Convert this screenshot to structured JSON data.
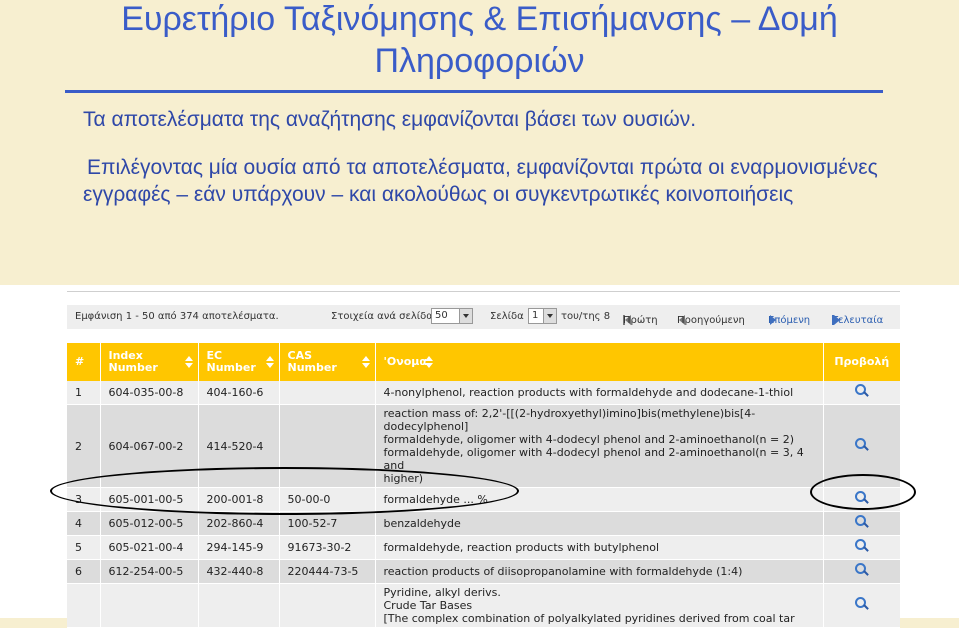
{
  "slide": {
    "title_line1": "Ευρετήριο Ταξινόμησης & Επισήμανσης – Δομή",
    "title_line2": "Πληροφοριών",
    "para1": "Τα αποτελέσματα της αναζήτησης εμφανίζονται βάσει των ουσιών.",
    "para2": "Επιλέγοντας μία ουσία από τα αποτελέσματα, εμφανίζονται πρώτα οι εναρμονισμένες εγγραφές – εάν υπάρχουν – και ακολούθως οι συγκεντρωτικές κοινοποιήσεις"
  },
  "pager": {
    "showing": "Εμφάνιση 1 - 50 από 374 αποτελέσματα.",
    "per_page_label": "Στοιχεία ανά σελίδα",
    "per_page_value": "50",
    "page_label": "Σελίδα",
    "page_value": "1",
    "of_label": "του/της 8",
    "first": "Πρώτη",
    "prev": "Προηγούμενη",
    "next": "Επόμενη",
    "last": "Τελευταία"
  },
  "table": {
    "headers": {
      "num": "#",
      "index": [
        "Index",
        "Number"
      ],
      "ec": [
        "EC",
        "Number"
      ],
      "cas": [
        "CAS",
        "Number"
      ],
      "name": "'Ονομα",
      "view": "Προβολή"
    },
    "rows": [
      {
        "num": "1",
        "index": "604-035-00-8",
        "ec": "404-160-6",
        "cas": "",
        "name": [
          "4-nonylphenol, reaction products with formaldehyde and dodecane-1-thiol"
        ]
      },
      {
        "num": "2",
        "index": "604-067-00-2",
        "ec": "414-520-4",
        "cas": "",
        "name": [
          "reaction mass of: 2,2'-[[(2-hydroxyethyl)imino]bis(methylene)bis[4-",
          "dodecylphenol]",
          "formaldehyde, oligomer with 4-dodecyl phenol and 2-aminoethanol(n = 2)",
          "formaldehyde, oligomer with 4-dodecyl phenol and 2-aminoethanol(n = 3, 4 and",
          "higher)"
        ]
      },
      {
        "num": "3",
        "index": "605-001-00-5",
        "ec": "200-001-8",
        "cas": "50-00-0",
        "name": [
          "formaldehyde ... %"
        ]
      },
      {
        "num": "4",
        "index": "605-012-00-5",
        "ec": "202-860-4",
        "cas": "100-52-7",
        "name": [
          "benzaldehyde"
        ]
      },
      {
        "num": "5",
        "index": "605-021-00-4",
        "ec": "294-145-9",
        "cas": "91673-30-2",
        "name": [
          "formaldehyde, reaction products with butylphenol"
        ]
      },
      {
        "num": "6",
        "index": "612-254-00-5",
        "ec": "432-440-8",
        "cas": "220444-73-5",
        "name": [
          "reaction products of diisopropanolamine with formaldehyde (1:4)"
        ]
      },
      {
        "num": "",
        "index": "",
        "ec": "",
        "cas": "",
        "name": [
          "Pyridine, alkyl derivs.",
          "Crude Tar Bases",
          "[The complex combination of polyalkylated pyridines derived from coal tar"
        ]
      }
    ]
  },
  "colors": {
    "title_blue": "#3a5cc8",
    "slide_bg": "#f7efd0",
    "header_yellow": "#ffc600",
    "row_odd": "#eeeeee",
    "row_even": "#dcdcdc"
  }
}
